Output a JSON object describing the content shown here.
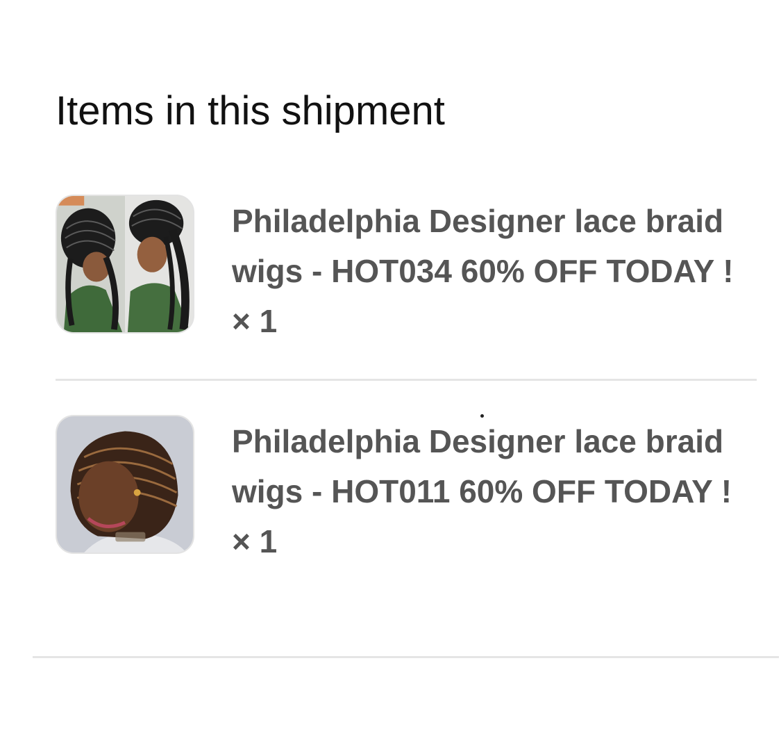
{
  "section": {
    "title": "Items in this shipment"
  },
  "items": [
    {
      "name": "Philadelphia Designer lace braid wigs - HOT034 60% OFF TODAY ! × 1",
      "thumbnail_icon": "product-photo-braids-two-views"
    },
    {
      "name": "Philadelphia Designer lace braid wigs - HOT011 60% OFF TODAY ! × 1",
      "thumbnail_icon": "product-photo-braided-bob"
    }
  ],
  "colors": {
    "title_text": "#111111",
    "item_text": "#555555",
    "divider": "#e5e5e5",
    "thumbnail_border": "#e3e3e3"
  }
}
